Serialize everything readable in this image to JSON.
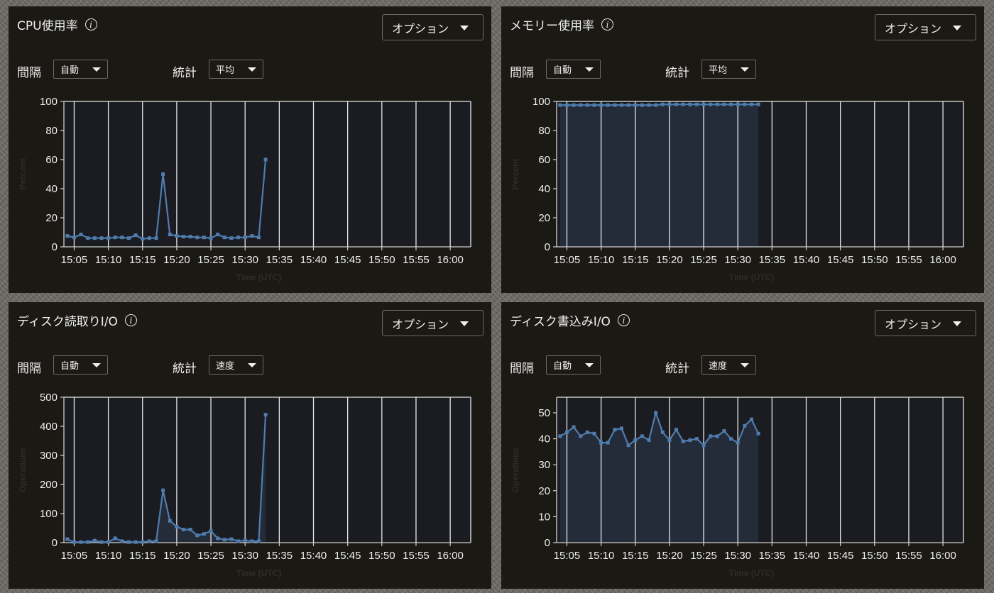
{
  "common": {
    "options_label": "オプション",
    "interval_label": "間隔",
    "stat_label": "統計",
    "interval_value": "自動",
    "x_ticks": [
      "15:05",
      "15:10",
      "15:15",
      "15:20",
      "15:25",
      "15:30",
      "15:35",
      "15:40",
      "15:45",
      "15:50",
      "15:55",
      "16:00"
    ]
  },
  "panels": [
    {
      "title": "CPU使用率",
      "stat_value": "平均",
      "chart_data": {
        "type": "line",
        "title": "CPU使用率",
        "xlabel": "Time (UTC)",
        "ylabel": "Percent",
        "ylim": [
          0,
          100
        ],
        "yticks": [
          0,
          20,
          40,
          60,
          80,
          100
        ],
        "x": [
          "15:04",
          "15:05",
          "15:06",
          "15:07",
          "15:08",
          "15:09",
          "15:10",
          "15:11",
          "15:12",
          "15:13",
          "15:14",
          "15:15",
          "15:16",
          "15:17",
          "15:18",
          "15:19",
          "15:20",
          "15:21",
          "15:22",
          "15:23",
          "15:24",
          "15:25",
          "15:26",
          "15:27",
          "15:28",
          "15:29",
          "15:30",
          "15:31",
          "15:32",
          "15:33"
        ],
        "values": [
          7.5,
          6.5,
          8.5,
          6,
          6,
          6,
          6,
          6.5,
          6.5,
          6,
          8,
          5.5,
          6,
          6,
          50,
          8.5,
          7.5,
          7,
          7,
          6.5,
          6.5,
          6,
          8.5,
          6.5,
          6,
          6.5,
          6.5,
          7.5,
          6.5,
          60
        ],
        "fill": false,
        "accent_color": "#4f7cad"
      }
    },
    {
      "title": "メモリー使用率",
      "stat_value": "平均",
      "chart_data": {
        "type": "area",
        "title": "メモリー使用率",
        "xlabel": "Time (UTC)",
        "ylabel": "Percent",
        "ylim": [
          0,
          100
        ],
        "yticks": [
          0,
          20,
          40,
          60,
          80,
          100
        ],
        "x": [
          "15:04",
          "15:05",
          "15:06",
          "15:07",
          "15:08",
          "15:09",
          "15:10",
          "15:11",
          "15:12",
          "15:13",
          "15:14",
          "15:15",
          "15:16",
          "15:17",
          "15:18",
          "15:19",
          "15:20",
          "15:21",
          "15:22",
          "15:23",
          "15:24",
          "15:25",
          "15:26",
          "15:27",
          "15:28",
          "15:29",
          "15:30",
          "15:31",
          "15:32",
          "15:33"
        ],
        "values": [
          97.5,
          97.5,
          97.5,
          97.5,
          97.5,
          97.5,
          97.5,
          97.5,
          97.5,
          97.5,
          97.5,
          97.5,
          97.5,
          97.5,
          97.5,
          98,
          98,
          98,
          98,
          98,
          98,
          98,
          98,
          98,
          98,
          98,
          98,
          98,
          98,
          98
        ],
        "fill": true,
        "accent_color": "#4f7cad"
      }
    },
    {
      "title": "ディスク読取りI/O",
      "stat_value": "速度",
      "chart_data": {
        "type": "area",
        "title": "ディスク読取りI/O",
        "xlabel": "Time (UTC)",
        "ylabel": "Operations",
        "ylim": [
          0,
          500
        ],
        "yticks": [
          0,
          100,
          200,
          300,
          400,
          500
        ],
        "x": [
          "15:04",
          "15:05",
          "15:06",
          "15:07",
          "15:08",
          "15:09",
          "15:10",
          "15:11",
          "15:12",
          "15:13",
          "15:14",
          "15:15",
          "15:16",
          "15:17",
          "15:18",
          "15:19",
          "15:20",
          "15:21",
          "15:22",
          "15:23",
          "15:24",
          "15:25",
          "15:26",
          "15:27",
          "15:28",
          "15:29",
          "15:30",
          "15:31",
          "15:32",
          "15:33"
        ],
        "values": [
          12,
          2,
          2,
          2,
          7,
          2,
          2,
          15,
          5,
          2,
          2,
          2,
          5,
          5,
          180,
          75,
          55,
          45,
          45,
          25,
          30,
          40,
          15,
          10,
          12,
          5,
          8,
          5,
          5,
          440
        ],
        "fill": true,
        "accent_color": "#4f7cad"
      }
    },
    {
      "title": "ディスク書込みI/O",
      "stat_value": "速度",
      "chart_data": {
        "type": "area",
        "title": "ディスク書込みI/O",
        "xlabel": "Time (UTC)",
        "ylabel": "Operations",
        "ylim": [
          0,
          56
        ],
        "yticks": [
          0,
          10,
          20,
          30,
          40,
          50
        ],
        "x": [
          "15:04",
          "15:05",
          "15:06",
          "15:07",
          "15:08",
          "15:09",
          "15:10",
          "15:11",
          "15:12",
          "15:13",
          "15:14",
          "15:15",
          "15:16",
          "15:17",
          "15:18",
          "15:19",
          "15:20",
          "15:21",
          "15:22",
          "15:23",
          "15:24",
          "15:25",
          "15:26",
          "15:27",
          "15:28",
          "15:29",
          "15:30",
          "15:31",
          "15:32",
          "15:33"
        ],
        "values": [
          41,
          42.5,
          44.5,
          41,
          42.5,
          42,
          38.5,
          38.5,
          43.5,
          44,
          37.5,
          39.5,
          41,
          39.5,
          50,
          42.5,
          39.5,
          43.5,
          39,
          39.5,
          40,
          37.5,
          41,
          41,
          43,
          40,
          38.5,
          45,
          47.5,
          42
        ],
        "fill": true,
        "accent_color": "#4f7cad"
      }
    }
  ]
}
